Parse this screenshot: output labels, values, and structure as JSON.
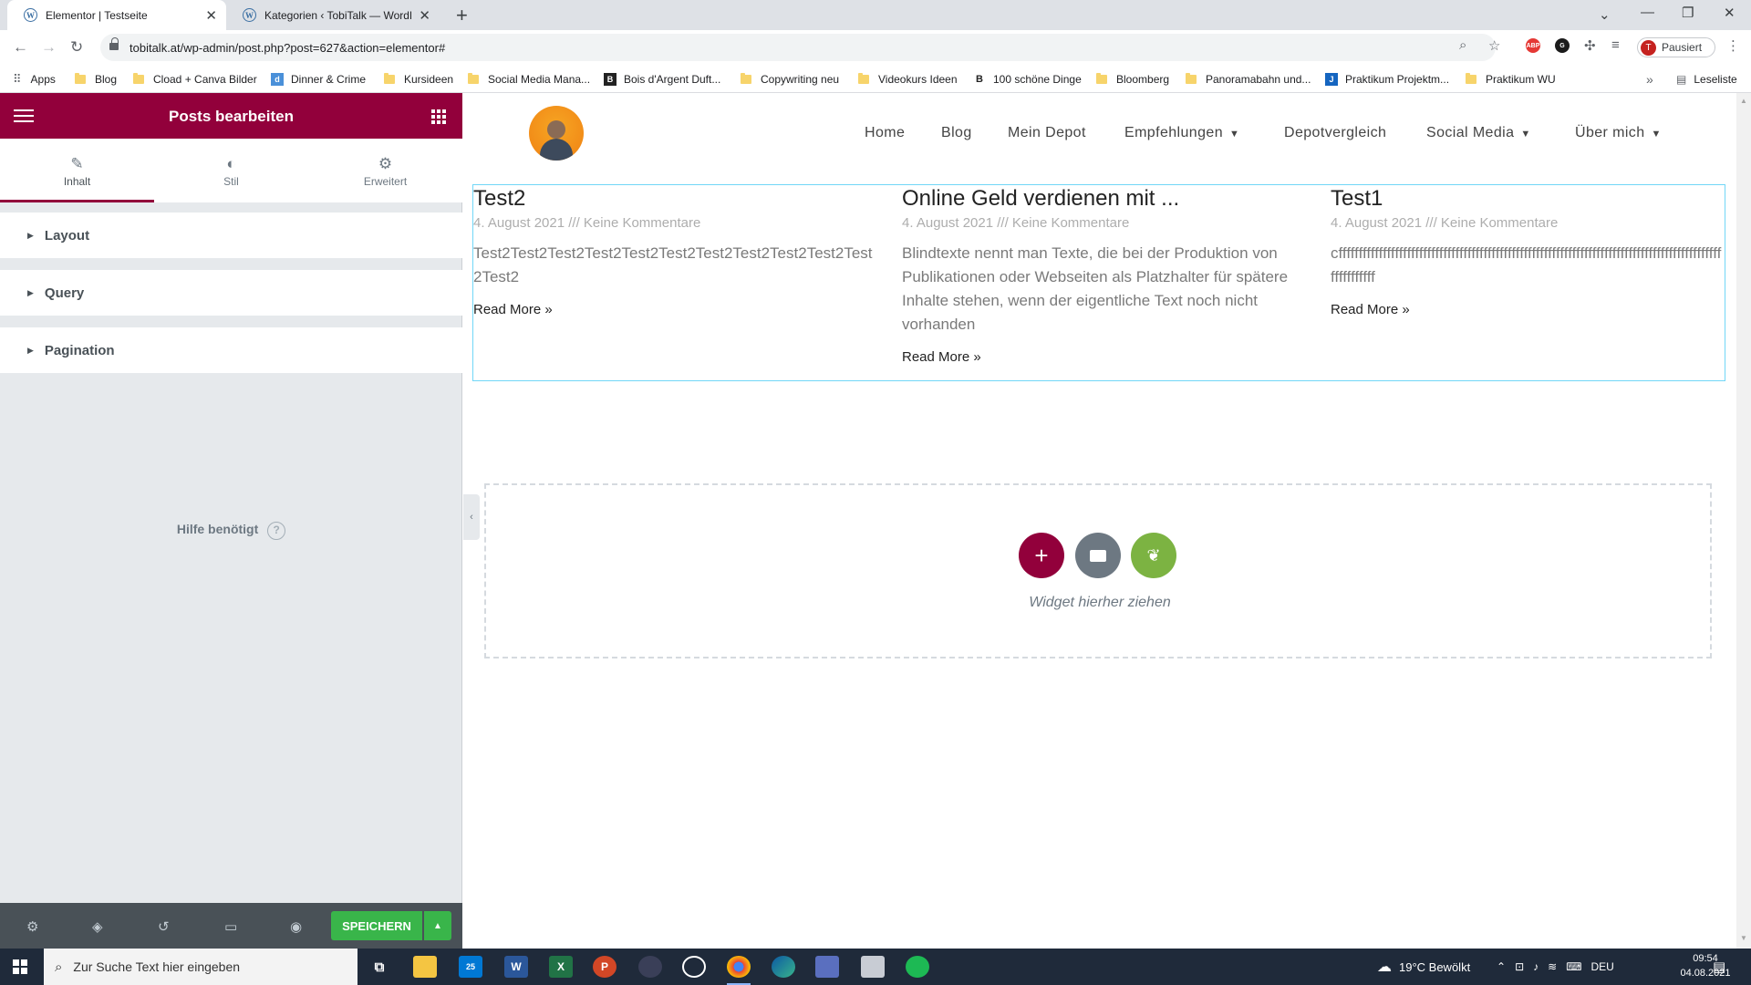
{
  "browser": {
    "tabs": [
      {
        "title": "Elementor | Testseite",
        "active": true
      },
      {
        "title": "Kategorien ‹ TobiTalk — WordPre",
        "active": false
      }
    ],
    "url": "tobitalk.at/wp-admin/post.php?post=627&action=elementor#",
    "profile_label": "Pausiert",
    "profile_initial": "T",
    "bookmarks": [
      "Apps",
      "Blog",
      "Cload + Canva Bilder",
      "Dinner & Crime",
      "Kursideen",
      "Social Media Mana...",
      "Bois d'Argent Duft...",
      "Copywriting neu",
      "Videokurs Ideen",
      "100 schöne Dinge",
      "Bloomberg",
      "Panoramabahn und...",
      "Praktikum Projektm...",
      "Praktikum WU"
    ],
    "reading_list": "Leseliste"
  },
  "panel": {
    "title": "Posts bearbeiten",
    "tabs": [
      {
        "label": "Inhalt",
        "icon": "pencil-icon"
      },
      {
        "label": "Stil",
        "icon": "half-circle-icon"
      },
      {
        "label": "Erweitert",
        "icon": "gear-icon"
      }
    ],
    "sections": [
      "Layout",
      "Query",
      "Pagination"
    ],
    "help_label": "Hilfe benötigt",
    "save_label": "SPEICHERN"
  },
  "site": {
    "nav": [
      "Home",
      "Blog",
      "Mein Depot",
      "Empfehlungen",
      "Depotvergleich",
      "Social Media",
      "Über mich"
    ],
    "posts": [
      {
        "title": "Test2",
        "meta": "4. August 2021 /// Keine Kommentare",
        "excerpt": "Test2Test2Test2Test2Test2Test2Test2Test2Test2Test2Test2Test2",
        "read_more": "Read More »"
      },
      {
        "title": "Online Geld verdienen mit ...",
        "meta": "4. August 2021 /// Keine Kommentare",
        "excerpt": "Blindtexte nennt man Texte, die bei der Produktion von Publikationen oder Webseiten als Platzhalter für spätere Inhalte stehen, wenn der eigentliche Text noch nicht vorhanden",
        "read_more": "Read More »"
      },
      {
        "title": "Test1",
        "meta": "4. August 2021 /// Keine Kommentare",
        "excerpt": "cffffffffffffffffffffffffffffffffffffffffffffffffffffffffffffffffffffffffffffffffffffffffffffffffffffffffff",
        "read_more": "Read More »"
      }
    ],
    "dropzone_text": "Widget hierher ziehen"
  },
  "taskbar": {
    "search_placeholder": "Zur Suche Text hier eingeben",
    "weather": "19°C  Bewölkt",
    "language": "DEU",
    "time": "09:54",
    "date": "04.08.2021",
    "mail_badge": "25"
  },
  "colors": {
    "elementor_accent": "#92003b",
    "save_green": "#39b54a",
    "panel_bg": "#e6e9ec",
    "template_green": "#7cb342",
    "folder_gray": "#6d7882"
  }
}
